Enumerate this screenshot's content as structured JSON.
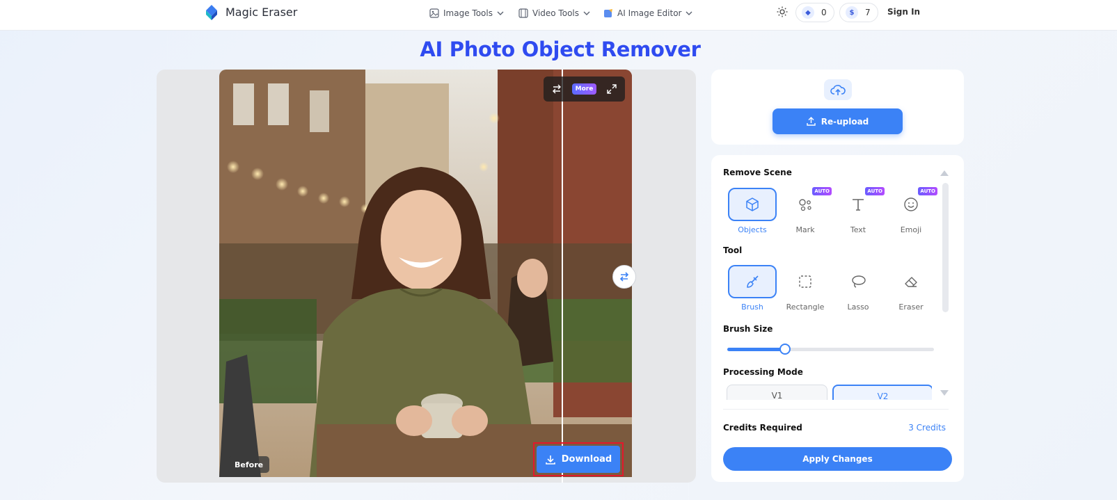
{
  "header": {
    "app_name": "Magic Eraser",
    "nav": [
      {
        "label": "Image Tools",
        "icon": "image-icon"
      },
      {
        "label": "Video Tools",
        "icon": "film-icon"
      },
      {
        "label": "AI Image Editor",
        "icon": "ai-edit-icon"
      }
    ],
    "gem_count": "0",
    "coin_count": "7",
    "sign_in": "Sign In",
    "theme_icon": "sun-icon"
  },
  "page_title": "AI Photo Object Remover",
  "canvas": {
    "more_label": "More",
    "before_label": "Before",
    "download_label": "Download",
    "colors": {
      "highlight": "#e3182b",
      "accent": "#3b82f6"
    }
  },
  "upload": {
    "reupload_label": "Re-upload",
    "icon": "cloud-upload-icon"
  },
  "remove_scene": {
    "title": "Remove Scene",
    "options": [
      {
        "label": "Objects",
        "icon": "cube-icon",
        "auto": "",
        "active": true
      },
      {
        "label": "Mark",
        "icon": "watermark-icon",
        "auto": "AUTO",
        "active": false
      },
      {
        "label": "Text",
        "icon": "text-icon",
        "auto": "AUTO",
        "active": false
      },
      {
        "label": "Emoji",
        "icon": "smiley-icon",
        "auto": "AUTO",
        "active": false
      }
    ]
  },
  "tool": {
    "title": "Tool",
    "options": [
      {
        "label": "Brush",
        "icon": "brush-icon",
        "active": true
      },
      {
        "label": "Rectangle",
        "icon": "rectangle-select-icon",
        "active": false
      },
      {
        "label": "Lasso",
        "icon": "lasso-icon",
        "active": false
      },
      {
        "label": "Eraser",
        "icon": "eraser-icon",
        "active": false
      }
    ]
  },
  "brush_size": {
    "title": "Brush Size",
    "value_fraction": 0.28
  },
  "processing_mode": {
    "title": "Processing Mode",
    "options": [
      {
        "label": "V1",
        "active": false
      },
      {
        "label": "V2",
        "active": true
      }
    ]
  },
  "credits": {
    "label": "Credits Required",
    "value": "3 Credits"
  },
  "apply_label": "Apply Changes"
}
